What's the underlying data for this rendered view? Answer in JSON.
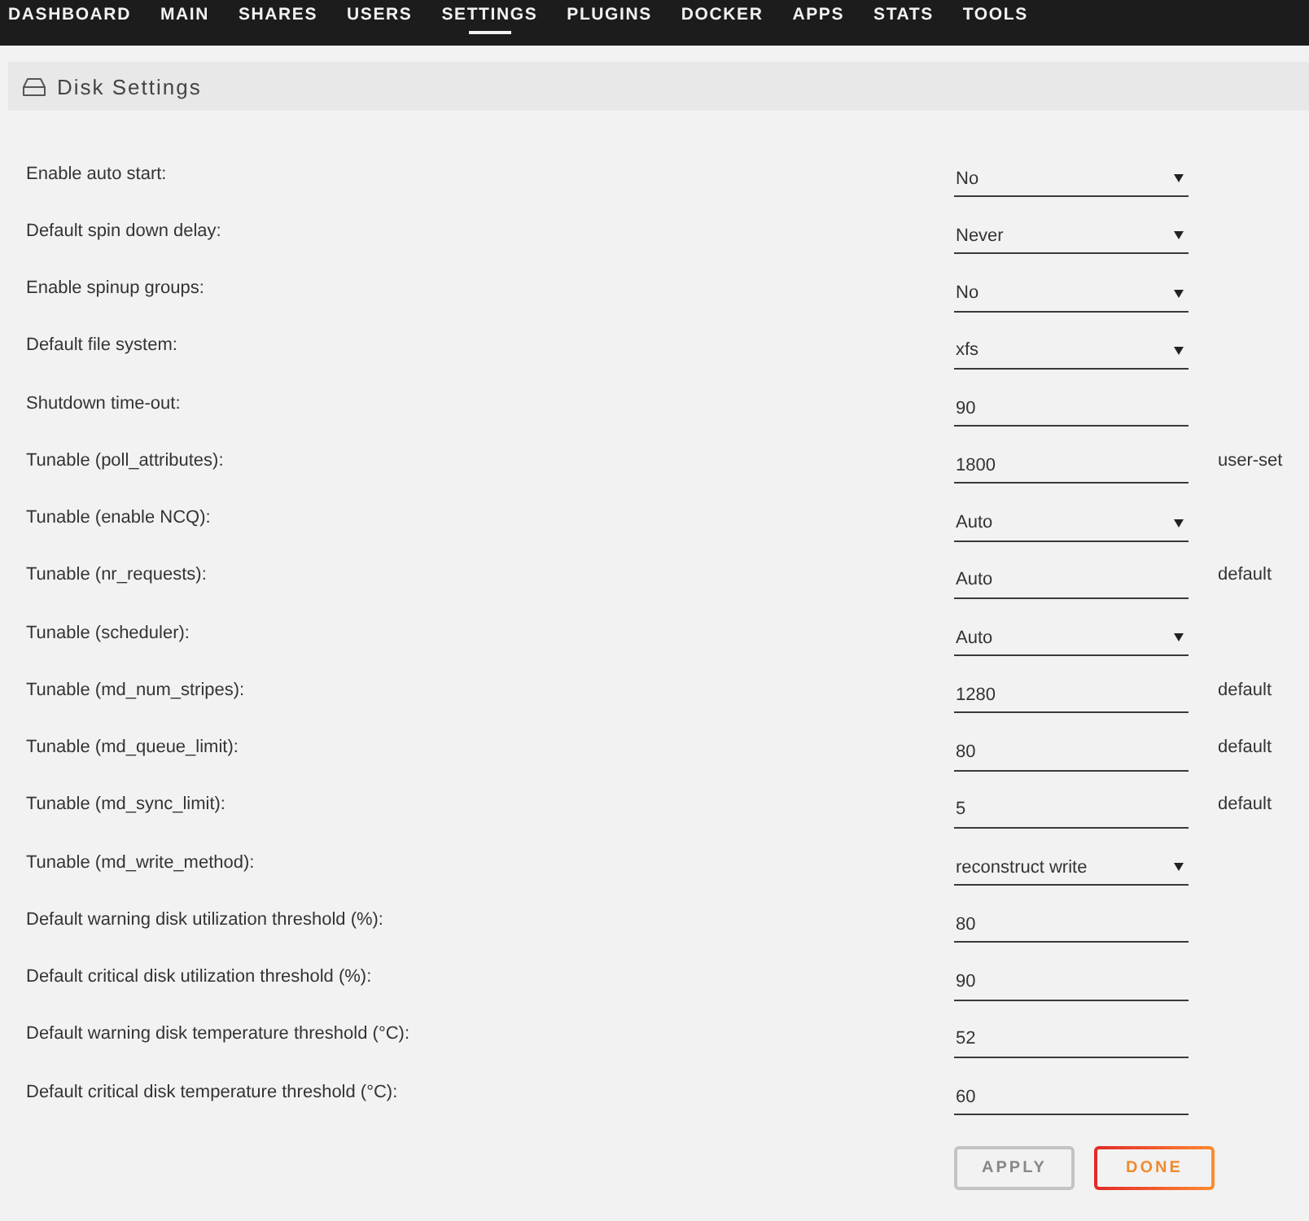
{
  "nav": {
    "items": [
      {
        "label": "DASHBOARD",
        "selected": false
      },
      {
        "label": "MAIN",
        "selected": false
      },
      {
        "label": "SHARES",
        "selected": false
      },
      {
        "label": "USERS",
        "selected": false
      },
      {
        "label": "SETTINGS",
        "selected": true
      },
      {
        "label": "PLUGINS",
        "selected": false
      },
      {
        "label": "DOCKER",
        "selected": false
      },
      {
        "label": "APPS",
        "selected": false
      },
      {
        "label": "STATS",
        "selected": false
      },
      {
        "label": "TOOLS",
        "selected": false
      }
    ]
  },
  "panel": {
    "title": "Disk Settings"
  },
  "settings": [
    {
      "label": "Enable auto start:",
      "kind": "select",
      "value": "No"
    },
    {
      "label": "Default spin down delay:",
      "kind": "select",
      "value": "Never"
    },
    {
      "label": "Enable spinup groups:",
      "kind": "select",
      "value": "No"
    },
    {
      "label": "Default file system:",
      "kind": "select",
      "value": "xfs"
    },
    {
      "label": "Shutdown time-out:",
      "kind": "input",
      "value": "90"
    },
    {
      "label": "Tunable (poll_attributes):",
      "kind": "input",
      "value": "1800",
      "note": "user-set"
    },
    {
      "label": "Tunable (enable NCQ):",
      "kind": "select",
      "value": "Auto"
    },
    {
      "label": "Tunable (nr_requests):",
      "kind": "input",
      "value": "Auto",
      "note": "default"
    },
    {
      "label": "Tunable (scheduler):",
      "kind": "select",
      "value": "Auto"
    },
    {
      "label": "Tunable (md_num_stripes):",
      "kind": "input",
      "value": "1280",
      "note": "default"
    },
    {
      "label": "Tunable (md_queue_limit):",
      "kind": "input",
      "value": "80",
      "note": "default"
    },
    {
      "label": "Tunable (md_sync_limit):",
      "kind": "input",
      "value": "5",
      "note": "default"
    },
    {
      "label": "Tunable (md_write_method):",
      "kind": "select",
      "value": "reconstruct write"
    },
    {
      "label": "Default warning disk utilization threshold (%):",
      "kind": "input",
      "value": "80"
    },
    {
      "label": "Default critical disk utilization threshold (%):",
      "kind": "input",
      "value": "90"
    },
    {
      "label": "Default warning disk temperature threshold (°C):",
      "kind": "input",
      "value": "52"
    },
    {
      "label": "Default critical disk temperature threshold (°C):",
      "kind": "input",
      "value": "60"
    }
  ],
  "buttons": [
    {
      "label": "APPLY",
      "disabled": true
    },
    {
      "label": "DONE",
      "disabled": false
    }
  ]
}
